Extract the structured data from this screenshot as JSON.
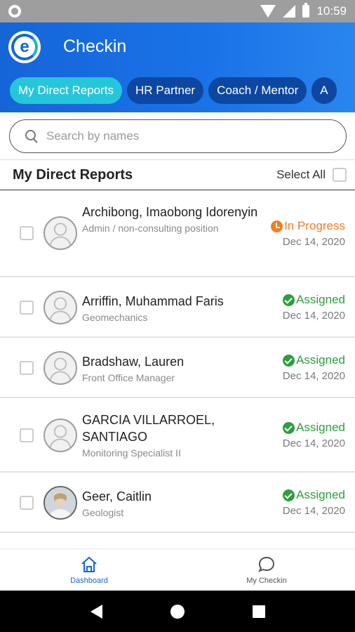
{
  "status_bar": {
    "time": "10:59"
  },
  "app": {
    "title": "Checkin"
  },
  "tabs": [
    {
      "label": "My Direct Reports",
      "active": true
    },
    {
      "label": "HR Partner",
      "active": false
    },
    {
      "label": "Coach / Mentor",
      "active": false
    },
    {
      "label": "A",
      "active": false
    }
  ],
  "search": {
    "placeholder": "Search by names",
    "value": ""
  },
  "section": {
    "title": "My Direct Reports",
    "select_all_label": "Select All"
  },
  "employees": [
    {
      "name": "Archibong, Imaobong Idorenyin",
      "role": "Admin / non-consulting position",
      "status": "In Progress",
      "status_icon": "clock-icon",
      "status_color": "#f47c20",
      "date": "Dec 14, 2020"
    },
    {
      "name": "Arriffin, Muhammad Faris",
      "role": "Geomechanics",
      "status": "Assigned",
      "status_icon": "check-circle-icon",
      "status_color": "#2e9e3e",
      "date": "Dec 14, 2020"
    },
    {
      "name": "Bradshaw, Lauren",
      "role": "Front Office Manager",
      "status": "Assigned",
      "status_icon": "check-circle-icon",
      "status_color": "#2e9e3e",
      "date": "Dec 14, 2020"
    },
    {
      "name": "GARCIA VILLARROEL, SANTIAGO",
      "role": "Monitoring Specialist II",
      "status": "Assigned",
      "status_icon": "check-circle-icon",
      "status_color": "#2e9e3e",
      "date": "Dec 14, 2020"
    },
    {
      "name": "Geer, Caitlin",
      "role": "Geologist",
      "status": "Assigned",
      "status_icon": "check-circle-icon",
      "status_color": "#2e9e3e",
      "date": "Dec 14, 2020"
    }
  ],
  "bottom_nav": [
    {
      "label": "Dashboard",
      "icon": "home-icon",
      "active": true
    },
    {
      "label": "My Checkin",
      "icon": "chat-bubble-icon",
      "active": false
    }
  ],
  "colors": {
    "brand_blue": "#1565d8",
    "active_tab": "#26c6da",
    "assigned": "#2e9e3e",
    "in_progress": "#f47c20"
  }
}
